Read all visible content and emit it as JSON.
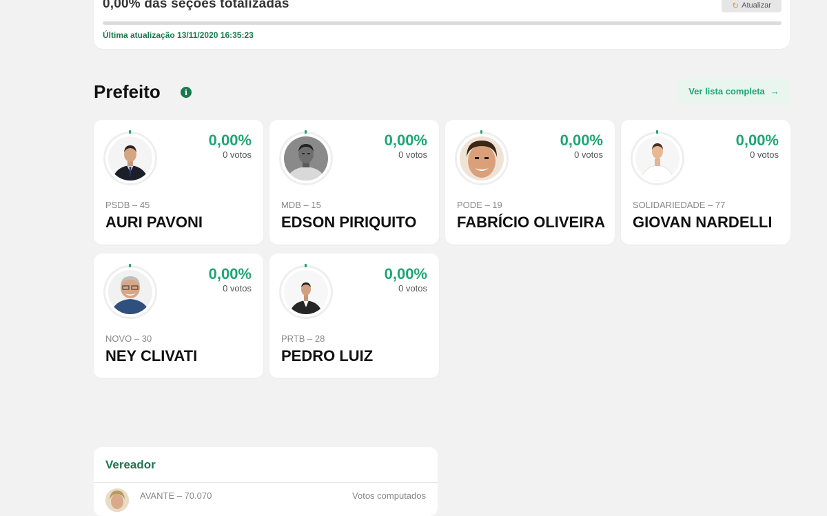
{
  "status": {
    "sections_text": "0,00% das seções totalizadas",
    "progress_percent": 0,
    "refresh_label": "Atualizar",
    "last_update": "Última atualização 13/11/2020 16:35:23"
  },
  "mayor": {
    "title": "Prefeito",
    "info_icon": "i",
    "full_list_label": "Ver lista completa",
    "full_list_arrow": "→",
    "candidates": [
      {
        "percent": "0,00%",
        "votes": "0 votos",
        "party": "PSDB – 45",
        "name": "AURI PAVONI"
      },
      {
        "percent": "0,00%",
        "votes": "0 votos",
        "party": "MDB – 15",
        "name": "EDSON PIRIQUITO"
      },
      {
        "percent": "0,00%",
        "votes": "0 votos",
        "party": "PODE – 19",
        "name": "FABRÍCIO OLIVEIRA"
      },
      {
        "percent": "0,00%",
        "votes": "0 votos",
        "party": "SOLIDARIEDADE – 77",
        "name": "GIOVAN NARDELLI"
      },
      {
        "percent": "0,00%",
        "votes": "0 votos",
        "party": "NOVO – 30",
        "name": "NEY CLIVATI"
      },
      {
        "percent": "0,00%",
        "votes": "0 votos",
        "party": "PRTB – 28",
        "name": "PEDRO LUIZ"
      }
    ]
  },
  "councilor": {
    "title": "Vereador",
    "first_party": "AVANTE – 70.070",
    "votes_label": "Votos computados"
  },
  "colors": {
    "accent_green": "#1ea672",
    "dark_green": "#1a7a4e",
    "background": "#f2f2f2"
  }
}
